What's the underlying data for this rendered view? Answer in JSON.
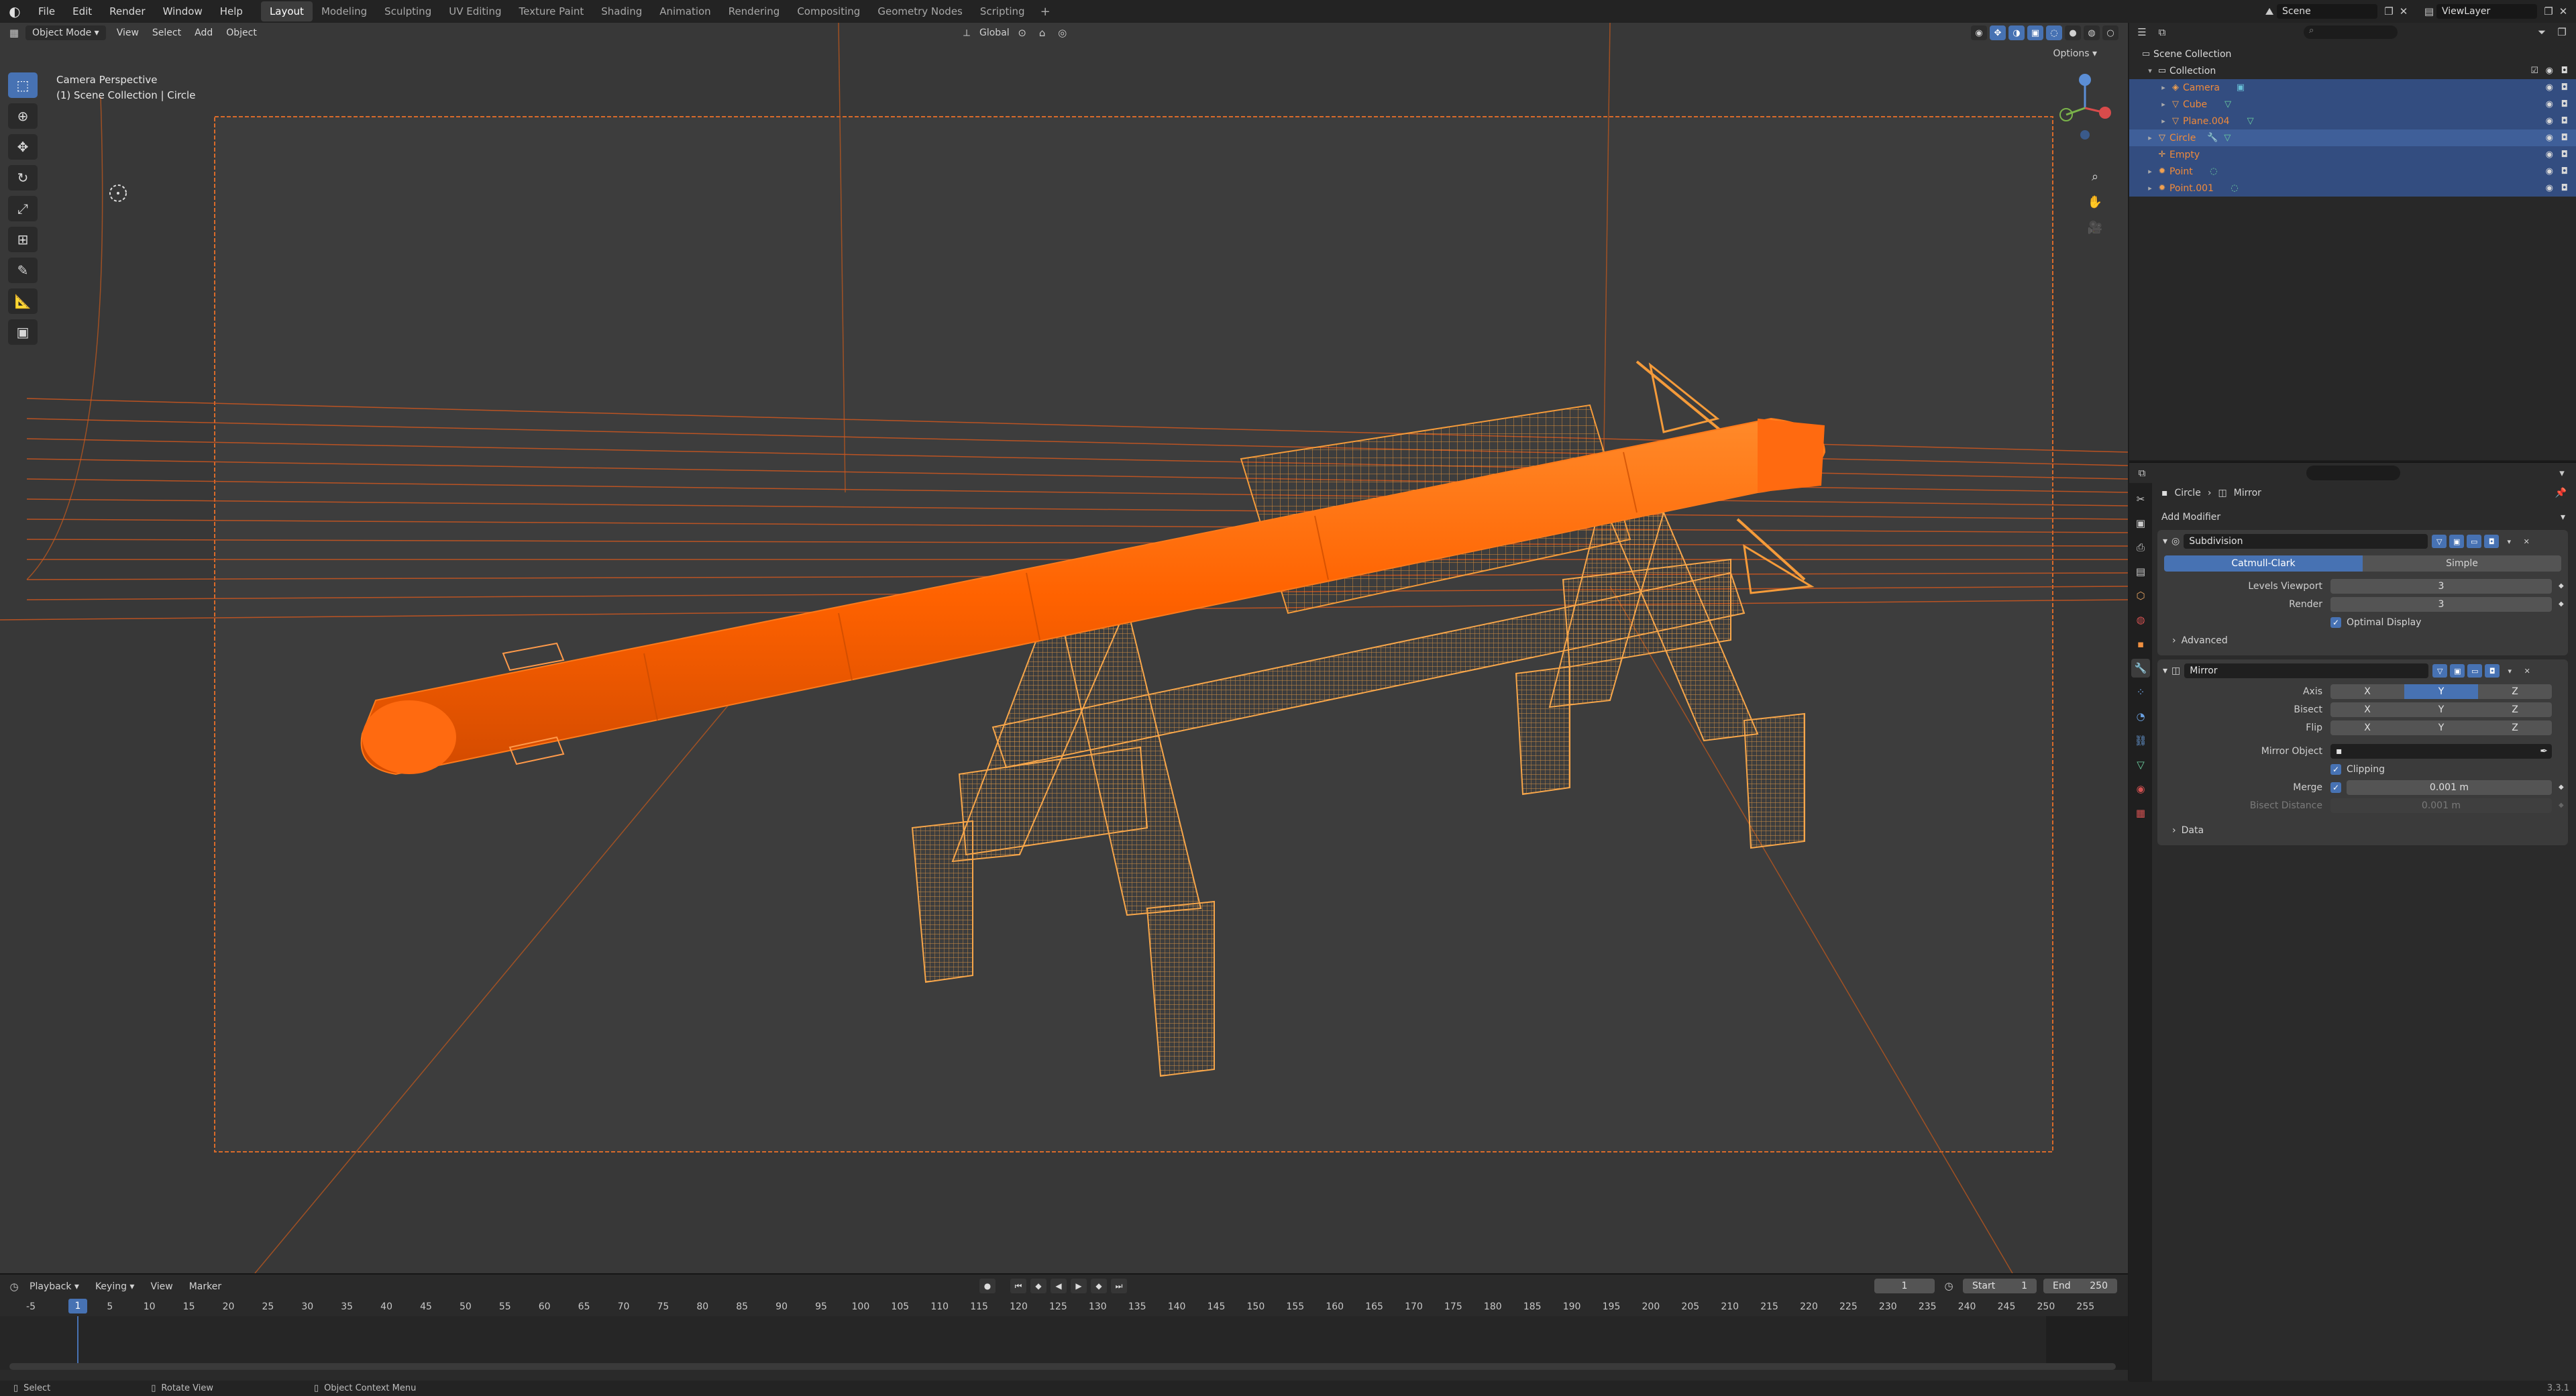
{
  "topbar": {
    "menus": [
      "File",
      "Edit",
      "Render",
      "Window",
      "Help"
    ],
    "workspaces": [
      "Layout",
      "Modeling",
      "Sculpting",
      "UV Editing",
      "Texture Paint",
      "Shading",
      "Animation",
      "Rendering",
      "Compositing",
      "Geometry Nodes",
      "Scripting"
    ],
    "active_workspace": "Layout",
    "add_symbol": "+",
    "scene": "Scene",
    "view_layer": "ViewLayer"
  },
  "viewport": {
    "mode": "Object Mode",
    "menus": [
      "View",
      "Select",
      "Add",
      "Object"
    ],
    "orientation": "Global",
    "options": "Options",
    "info_line1": "Camera Perspective",
    "info_line2": "(1) Scene Collection | Circle"
  },
  "timeline": {
    "menus": [
      "Playback",
      "Keying",
      "View",
      "Marker"
    ],
    "current_frame": "1",
    "start_label": "Start",
    "start": "1",
    "end_label": "End",
    "end": "250",
    "ruler": [
      "-5",
      "1",
      "5",
      "10",
      "15",
      "20",
      "25",
      "30",
      "35",
      "40",
      "45",
      "50",
      "55",
      "60",
      "65",
      "70",
      "75",
      "80",
      "85",
      "90",
      "95",
      "100",
      "105",
      "110",
      "115",
      "120",
      "125",
      "130",
      "135",
      "140",
      "145",
      "150",
      "155",
      "160",
      "165",
      "170",
      "175",
      "180",
      "185",
      "190",
      "195",
      "200",
      "205",
      "210",
      "215",
      "220",
      "225",
      "230",
      "235",
      "240",
      "245",
      "250",
      "255"
    ]
  },
  "statusbar": {
    "select": "Select",
    "rotate": "Rotate View",
    "context": "Object Context Menu",
    "version": "3.3.1"
  },
  "outliner": {
    "root": "Scene Collection",
    "collection": "Collection",
    "items": [
      "Camera",
      "Cube",
      "Plane.004",
      "Circle",
      "Empty",
      "Point",
      "Point.001"
    ]
  },
  "properties": {
    "crumb_object": "Circle",
    "crumb_modifier": "Mirror",
    "add_modifier": "Add Modifier",
    "subdivision": {
      "name": "Subdivision",
      "method_a": "Catmull-Clark",
      "method_b": "Simple",
      "levels_viewport_label": "Levels Viewport",
      "levels_viewport": "3",
      "render_label": "Render",
      "render": "3",
      "optimal_display": "Optimal Display",
      "advanced": "Advanced"
    },
    "mirror": {
      "name": "Mirror",
      "axis_label": "Axis",
      "bisect_label": "Bisect",
      "flip_label": "Flip",
      "x": "X",
      "y": "Y",
      "z": "Z",
      "mirror_object_label": "Mirror Object",
      "clipping": "Clipping",
      "merge_label": "Merge",
      "merge": "0.001 m",
      "bisect_distance_label": "Bisect Distance",
      "bisect_distance": "0.001 m",
      "data": "Data"
    }
  },
  "colors": {
    "accent": "#4772b3",
    "selected_orange": "#ff6a00",
    "wire_orange": "#f59b3a"
  }
}
